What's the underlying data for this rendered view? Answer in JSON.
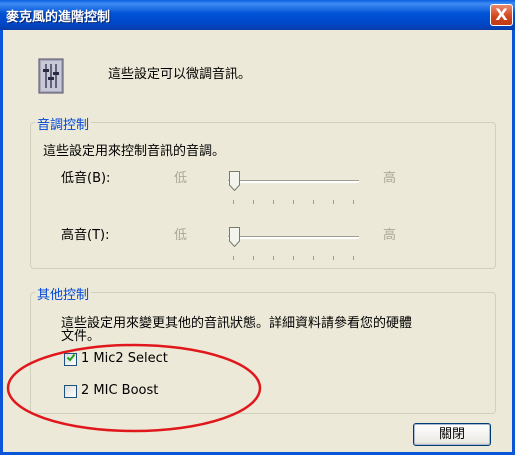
{
  "window": {
    "title": "麥克風的進階控制",
    "close_glyph": "X"
  },
  "header": {
    "description": "這些設定可以微調音訊。"
  },
  "tone_group": {
    "title": "音調控制",
    "description": "這些設定用來控制音訊的音調。",
    "bass": {
      "label": "低音(B):",
      "low": "低",
      "high": "高",
      "level": 0
    },
    "treble": {
      "label": "高音(T):",
      "low": "低",
      "high": "高",
      "level": 0
    }
  },
  "other_group": {
    "title": "其他控制",
    "description_line1": "這些設定用來變更其他的音訊狀態。詳細資料請參看您的硬體",
    "description_line2": "文件。",
    "options": [
      {
        "label": "1  Mic2 Select",
        "checked": true
      },
      {
        "label": "2  MIC Boost",
        "checked": false
      }
    ]
  },
  "buttons": {
    "close": "關閉"
  },
  "colors": {
    "title_bar": "#0054e3",
    "group_title": "#0046d5",
    "annotation": "#e0181c",
    "dialog_bg": "#ece9d8"
  },
  "icons": [
    "close-icon",
    "settings-icon",
    "checkmark-icon"
  ]
}
